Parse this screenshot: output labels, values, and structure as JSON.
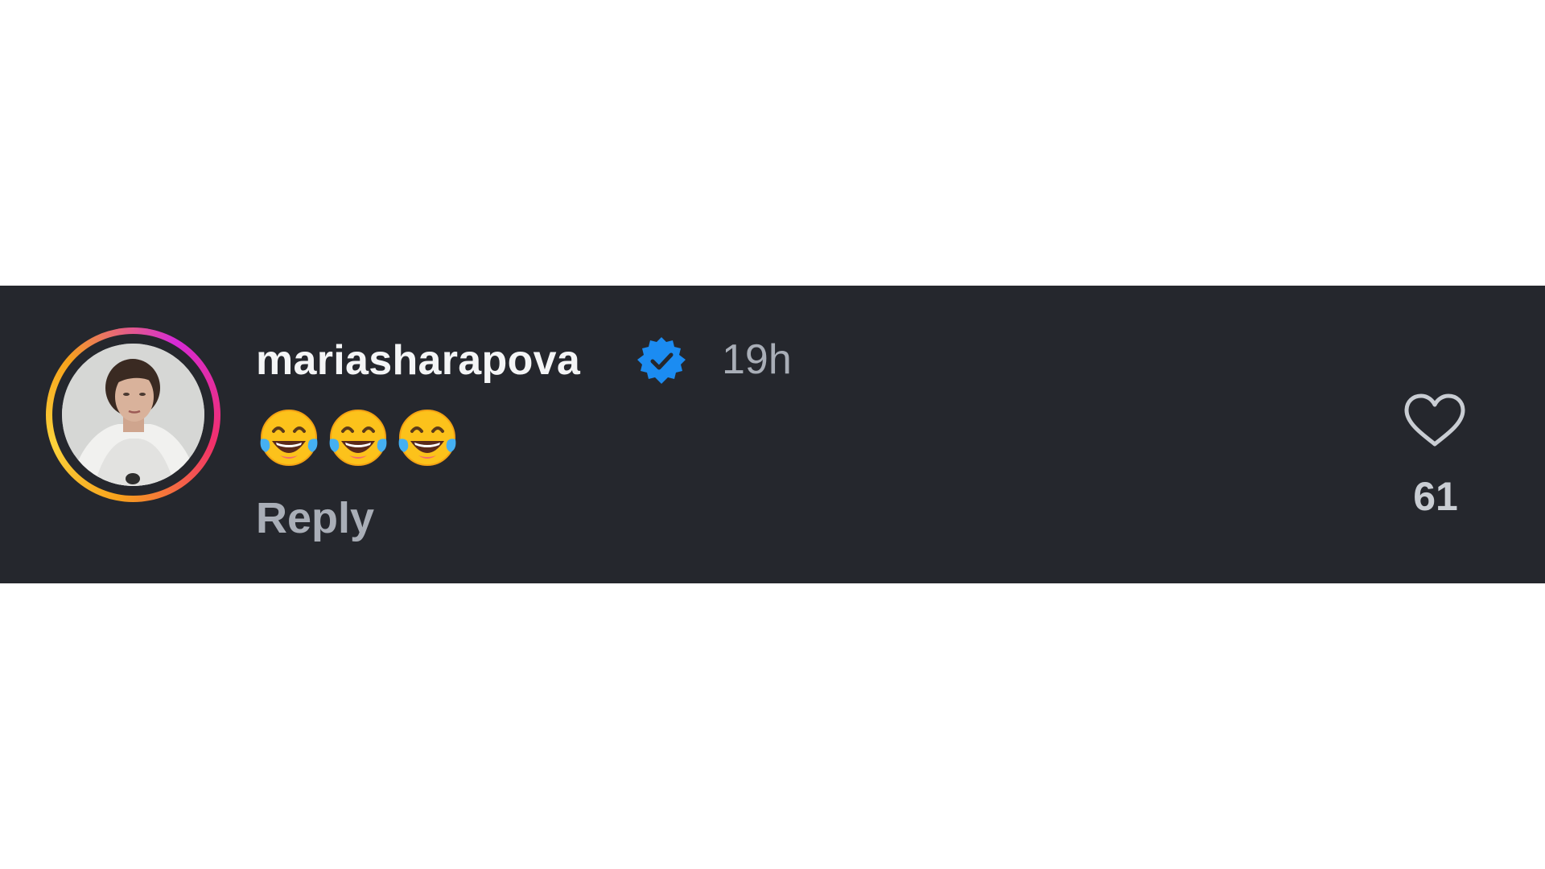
{
  "comment": {
    "username": "mariasharapova",
    "verified_icon": "verified-badge-icon",
    "verified_color": "#1b8cf2",
    "timestamp": "19h",
    "text_emojis": [
      "face-with-tears-of-joy-icon",
      "face-with-tears-of-joy-icon",
      "face-with-tears-of-joy-icon"
    ],
    "reply_label": "Reply",
    "like_icon": "heart-icon",
    "like_count": "61"
  },
  "colors": {
    "band_background": "#25272d",
    "username": "#f4f5f6",
    "muted_text": "#a9aeb7",
    "story_ring": [
      "#d62ad6",
      "#f2306a",
      "#f7a21c",
      "#fcd33b"
    ]
  }
}
